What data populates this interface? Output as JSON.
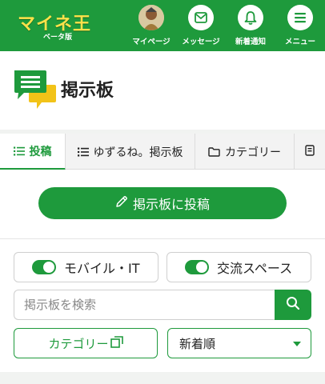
{
  "header": {
    "logo_text": "マイネ王",
    "logo_sub": "ベータ版",
    "nav": [
      {
        "label": "マイページ",
        "icon": "avatar"
      },
      {
        "label": "メッセージ",
        "icon": "envelope-icon"
      },
      {
        "label": "新着通知",
        "icon": "bell-icon"
      },
      {
        "label": "メニュー",
        "icon": "hamburger-icon"
      }
    ]
  },
  "page": {
    "title": "掲示板"
  },
  "tabs": [
    {
      "label": "投稿",
      "icon": "list-icon",
      "active": true
    },
    {
      "label": "ゆずるね。掲示板",
      "icon": "list-icon",
      "active": false
    },
    {
      "label": "カテゴリー",
      "icon": "folder-icon",
      "active": false
    },
    {
      "label": "",
      "icon": "notebook-icon",
      "active": false
    }
  ],
  "main": {
    "post_button": "掲示板に投稿"
  },
  "filters": {
    "toggles": [
      {
        "label": "モバイル・IT",
        "on": true
      },
      {
        "label": "交流スペース",
        "on": true
      }
    ],
    "search_placeholder": "掲示板を検索",
    "category_button": "カテゴリー",
    "sort_selected": "新着順"
  },
  "colors": {
    "brand_green": "#1e9a3c",
    "logo_yellow": "#ffe14a"
  }
}
